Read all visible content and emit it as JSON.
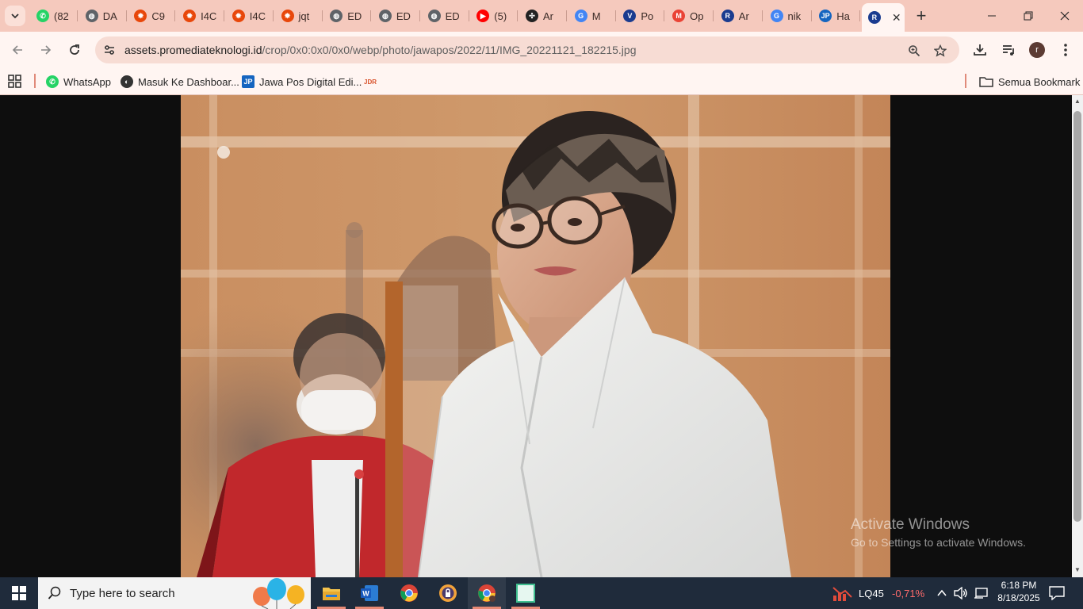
{
  "browser": {
    "tabs": [
      {
        "label": "(82",
        "icon": "whatsapp-icon",
        "color": "#25d366"
      },
      {
        "label": "DA",
        "icon": "globe-icon",
        "color": "#5f6368"
      },
      {
        "label": "C9",
        "icon": "flame-icon",
        "color": "#e8470a"
      },
      {
        "label": "I4C",
        "icon": "flame-icon",
        "color": "#e8470a"
      },
      {
        "label": "I4C",
        "icon": "flame-icon",
        "color": "#e8470a"
      },
      {
        "label": "jqt",
        "icon": "flame-icon",
        "color": "#e8470a"
      },
      {
        "label": "ED",
        "icon": "globe-icon",
        "color": "#5f6368"
      },
      {
        "label": "ED",
        "icon": "globe-icon",
        "color": "#5f6368"
      },
      {
        "label": "ED",
        "icon": "globe-icon",
        "color": "#5f6368"
      },
      {
        "label": "(5)",
        "icon": "youtube-icon",
        "color": "#ff0000"
      },
      {
        "label": "Ar",
        "icon": "openai-icon",
        "color": "#222222"
      },
      {
        "label": "M",
        "icon": "google-icon",
        "color": "#4285f4"
      },
      {
        "label": "Po",
        "icon": "vector-icon",
        "color": "#1a3b8f"
      },
      {
        "label": "Op",
        "icon": "gmail-icon",
        "color": "#ea4335"
      },
      {
        "label": "Ar",
        "icon": "ro-icon",
        "color": "#1a3b8f"
      },
      {
        "label": "nik",
        "icon": "google-icon",
        "color": "#4285f4"
      },
      {
        "label": "Ha",
        "icon": "jp-icon",
        "color": "#1565c0"
      },
      {
        "label": "",
        "icon": "ro-icon",
        "color": "#1a3b8f",
        "active": true
      }
    ],
    "address_bar": {
      "host": "assets.promediateknologi.id",
      "path": "/crop/0x0:0x0/0x0/webp/photo/jawapos/2022/11/IMG_20221121_182215.jpg"
    },
    "bookmarks": [
      {
        "label": "WhatsApp",
        "icon": "whatsapp-icon"
      },
      {
        "label": "Masuk Ke Dashboar...",
        "icon": "globe-icon"
      },
      {
        "label": "Jawa Pos Digital Edi...",
        "icon": "jp-icon"
      },
      {
        "label": "",
        "icon": "jdr-icon"
      }
    ],
    "all_bookmarks": "Semua Bookmark",
    "profile_initial": "r"
  },
  "watermark": {
    "line1": "Activate Windows",
    "line2": "Go to Settings to activate Windows."
  },
  "taskbar": {
    "search_placeholder": "Type here to search",
    "stock_ticker": "LQ45",
    "stock_change": "-0,71%",
    "time": "6:18 PM",
    "date": "8/18/2025"
  },
  "colors": {
    "tab_strip": "#f5c9bd",
    "toolbar": "#fff5f2",
    "omnibox": "#f7dcd4",
    "taskbar": "#1f2b3b",
    "stock_negative": "#ff6b6b"
  }
}
